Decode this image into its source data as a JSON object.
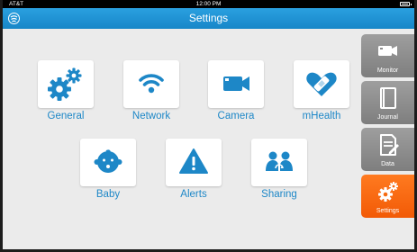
{
  "status": {
    "carrier": "AT&T",
    "time": "12:00 PM"
  },
  "header": {
    "title": "Settings"
  },
  "tiles": {
    "general": "General",
    "network": "Network",
    "camera": "Camera",
    "mhealth": "mHealth",
    "baby": "Baby",
    "alerts": "Alerts",
    "sharing": "Sharing"
  },
  "sidebar": {
    "monitor": "Monitor",
    "journal": "Journal",
    "data": "Data",
    "settings": "Settings"
  },
  "colors": {
    "accent": "#1d87c7",
    "header": "#1f92d6",
    "active_tab": "#f56a10",
    "inactive_tab": "#8c8c8c",
    "background": "#ebebeb"
  },
  "icons": {
    "general": "gears-icon",
    "network": "wifi-icon",
    "camera": "video-camera-icon",
    "mhealth": "heart-bandage-icon",
    "baby": "baby-face-icon",
    "alerts": "warning-triangle-icon",
    "sharing": "people-sharing-icon"
  }
}
